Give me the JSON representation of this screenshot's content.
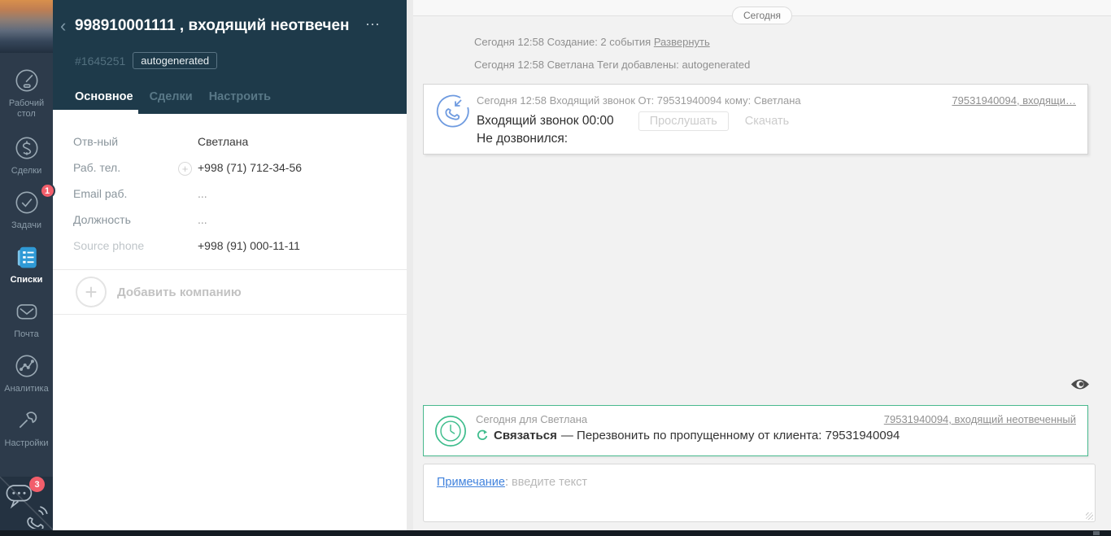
{
  "glyphs": {
    "back": "‹",
    "menu_dots": "⋯",
    "plus": "+"
  },
  "colors": {
    "sidebar_bg": "#2d3b4b",
    "header_bg": "#1e3a4a",
    "accent_green": "#3fbd8d",
    "accent_blue": "#6f9be0",
    "badge_red": "#f25e6b",
    "link_blue": "#4082dd",
    "lists_blue": "#2f9ad6"
  },
  "sidebar": {
    "items": [
      {
        "label": "Рабочий стол"
      },
      {
        "label": "Сделки"
      },
      {
        "label": "Задачи",
        "badge": "1"
      },
      {
        "label": "Списки",
        "active": true
      },
      {
        "label": "Почта"
      },
      {
        "label": "Аналитика"
      },
      {
        "label": "Настройки"
      }
    ],
    "chat_badge": "3"
  },
  "contact": {
    "title": "998910001111 , входящий неотвечен",
    "id": "#1645251",
    "tag": "autogenerated",
    "tabs": [
      {
        "label": "Основное"
      },
      {
        "label": "Сделки"
      },
      {
        "label": "Настроить"
      }
    ],
    "fields": [
      {
        "label": "Отв-ный",
        "value": "Светлана"
      },
      {
        "label": "Раб. тел.",
        "value": "+998 (71) 712-34-56"
      },
      {
        "label": "Email раб.",
        "value": "..."
      },
      {
        "label": "Должность",
        "value": "..."
      },
      {
        "label": "Source phone",
        "value": "+998 (91) 000-11-11"
      }
    ],
    "add_company": "Добавить компанию"
  },
  "feed": {
    "date_pill": "Сегодня",
    "event1_text": "Сегодня 12:58 Создание: 2 события ",
    "event1_link": "Развернуть",
    "event2_text": "Сегодня 12:58 Светлана  Теги добавлены: autogenerated",
    "call_card": {
      "meta": "Сегодня 12:58 Входящий звонок От: 79531940094 кому: Светлана",
      "link": "79531940094, входящи…",
      "duration_line": "Входящий звонок 00:00",
      "listen_label": "Прослушать",
      "download_label": "Скачать",
      "result": "Не дозвонился:"
    },
    "task_card": {
      "meta": "Сегодня для Светлана",
      "link": "79531940094, входящий неотвеченный",
      "type": "Связаться",
      "text": "— Перезвонить по пропущенному от клиента: 79531940094"
    },
    "note": {
      "label": "Примечание",
      "colon": ": ",
      "placeholder": "введите текст"
    }
  }
}
